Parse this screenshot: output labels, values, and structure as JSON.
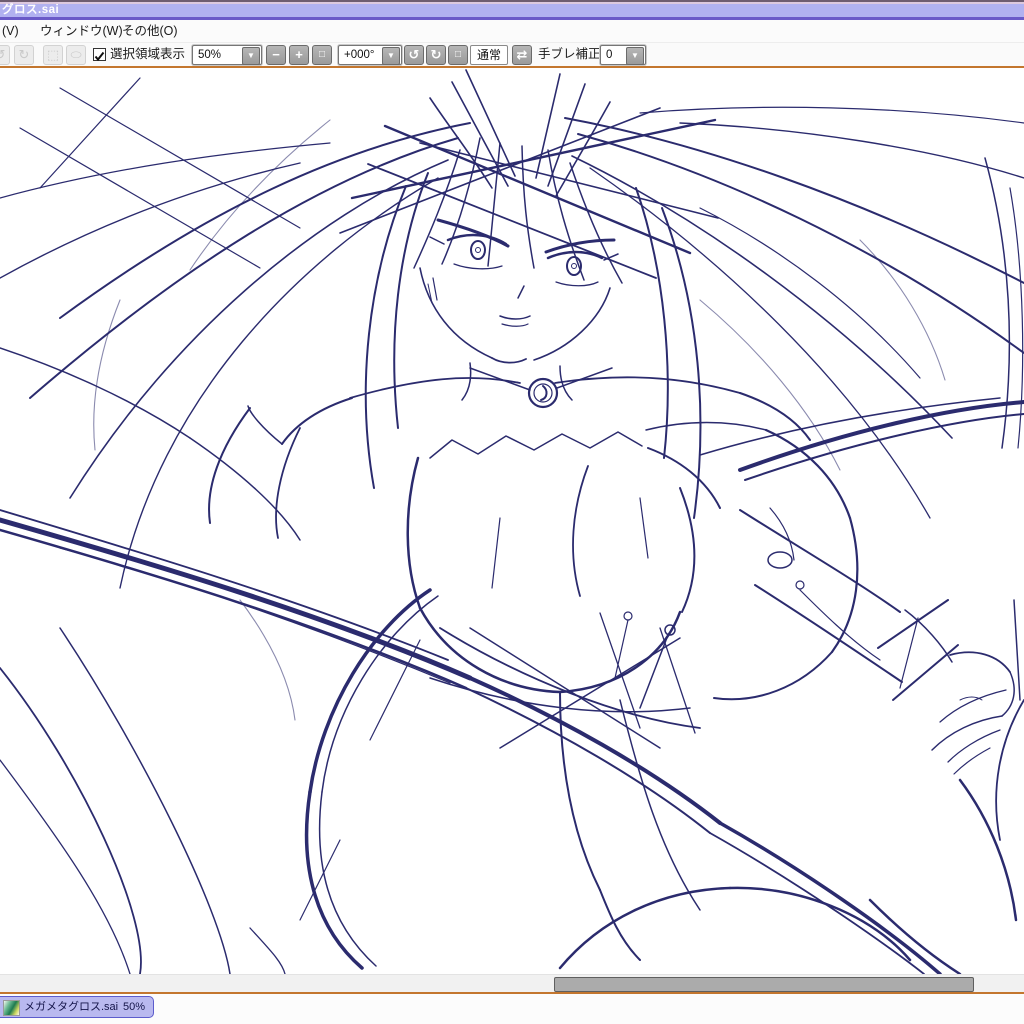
{
  "window": {
    "title": "グロス.sai"
  },
  "menubar": {
    "items": [
      {
        "label": "(V)"
      },
      {
        "label": "ウィンドウ(W)"
      },
      {
        "label": "その他(O)"
      }
    ]
  },
  "toolbar": {
    "selection_area_label": "選択領域表示",
    "selection_area_checked": true,
    "zoom_value": "50%",
    "angle_value": "+000°",
    "blend_mode_label": "通常",
    "stabilizer_label": "手ブレ補正",
    "stabilizer_value": "0",
    "icons": {
      "undo": "↺",
      "redo": "↻",
      "transform_selection": "⬚",
      "ellipse_selection": "⬭",
      "zoom_out": "−",
      "zoom_in": "+",
      "zoom_reset": "□",
      "rotate_ccw": "↺",
      "rotate_cw": "↻",
      "rotate_reset": "□",
      "flip_horizontal": "⇄",
      "dropdown": "▼"
    }
  },
  "canvas": {
    "content": "rough pencil sketch of a long-haired anime girl, dark indigo lines on white",
    "sketch_line_color": "#2b2b6e"
  },
  "statusbar": {
    "tab": {
      "name": "メガメタグロス.sai",
      "zoom": "50%"
    }
  },
  "colors": {
    "titlebar_bg": "#b1b1f0",
    "titlebar_accent": "#6a5ac8",
    "frame_border": "#c3762e",
    "tab_bg": "#b9b9ef",
    "tab_border": "#5c5ccc",
    "scrollbar_thumb": "#ababab"
  }
}
